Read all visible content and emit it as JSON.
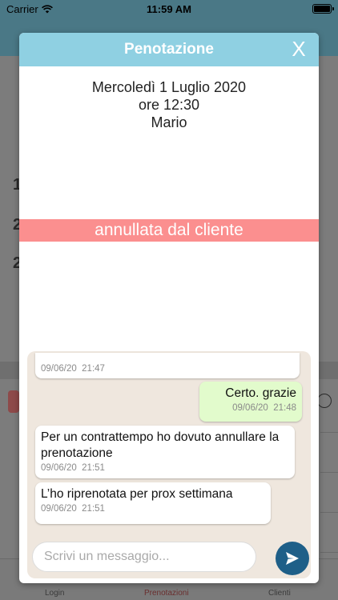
{
  "status_bar": {
    "carrier": "Carrier",
    "time": "11:59 AM"
  },
  "background": {
    "tabs": [
      {
        "label": "Login"
      },
      {
        "label": "Prenotazioni",
        "active": true
      },
      {
        "label": "Clienti"
      }
    ]
  },
  "modal": {
    "title": "Penotazione",
    "close_label": "X",
    "booking": {
      "date": "Mercoledì 1 Luglio 2020",
      "time": "ore 12:30",
      "client": "Mario"
    },
    "status": "annullata dal cliente",
    "colors": {
      "header": "#8fd0e2",
      "status": "#fb8f8f",
      "chat_bg": "#efe7de",
      "outgoing": "#e2fbcc",
      "send": "#1e5f88"
    }
  },
  "chat": {
    "messages": [
      {
        "direction": "in",
        "text": "",
        "date": "09/06/20",
        "time": "21:47"
      },
      {
        "direction": "out",
        "text": "Certo. grazie",
        "date": "09/06/20",
        "time": "21:48"
      },
      {
        "direction": "in",
        "text": "Per un contrattempo ho dovuto annullare la prenotazione",
        "date": "09/06/20",
        "time": "21:51"
      },
      {
        "direction": "in",
        "text": "L’ho riprenotata per prox settimana",
        "date": "09/06/20",
        "time": "21:51"
      }
    ],
    "composer": {
      "placeholder": "Scrivi un messaggio...",
      "value": ""
    },
    "send_icon": "send-icon"
  }
}
